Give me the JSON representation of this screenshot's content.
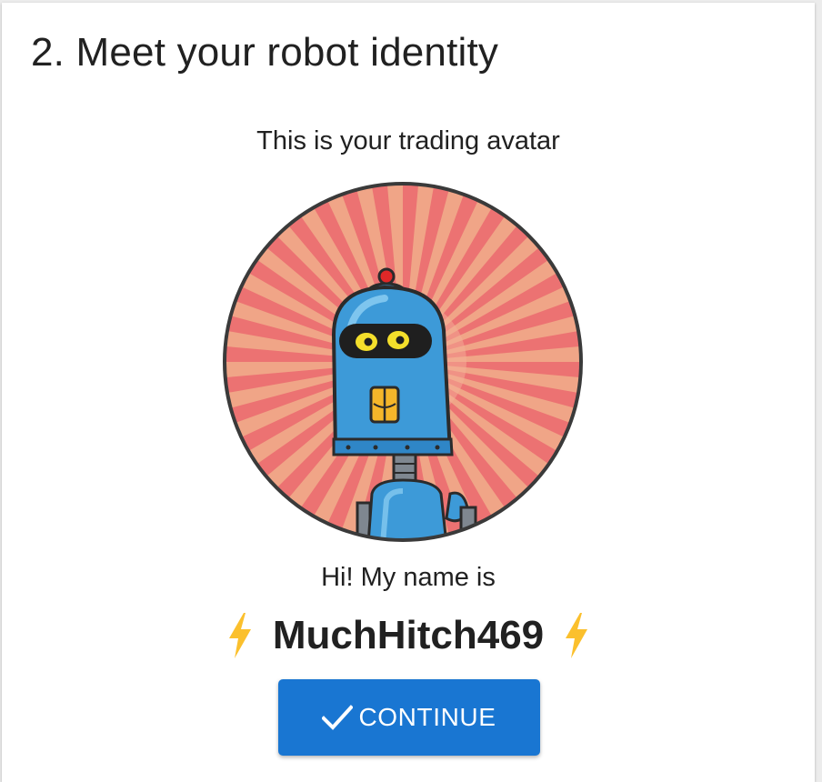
{
  "step": {
    "title": "2. Meet your robot identity",
    "subtitle": "This is your trading avatar"
  },
  "avatar": {
    "icon": "robot-avatar"
  },
  "identity": {
    "greeting": "Hi! My name is",
    "robot_name": "MuchHitch469",
    "decor_icon": "lightning-bolt-icon"
  },
  "actions": {
    "continue_label": "CONTINUE",
    "continue_icon": "check-icon"
  },
  "colors": {
    "primary": "#1976d2",
    "bolt": "#fbc02d",
    "ray_dark": "#ec7272",
    "ray_light": "#f0a587",
    "robot_blue": "#3d9ad8"
  }
}
